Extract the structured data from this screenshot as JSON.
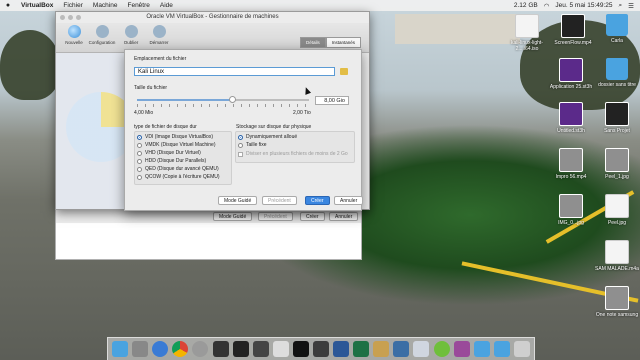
{
  "menubar": {
    "app_name": "VirtualBox",
    "menus": [
      "Fichier",
      "Machine",
      "Fenêtre",
      "Aide"
    ],
    "battery": "2.12 GB",
    "datetime": "Jeu. 5 mai 15:49:25",
    "user": "Carla"
  },
  "vbox_window": {
    "title": "Oracle VM VirtualBox - Gestionnaire de machines",
    "toolbar": [
      "Nouvelle",
      "Configuration",
      "Oublier",
      "Démarrer"
    ],
    "segments": [
      "Détails",
      "Instantanés"
    ]
  },
  "dialog": {
    "location_label": "Emplacement du fichier",
    "location_value": "Kali Linux",
    "size_label": "Taille du fichier",
    "size_value": "8,00 Gio",
    "size_fraction": 0.55,
    "size_min": "4,00 Mio",
    "size_max": "2,00 Tio",
    "type_label": "type de fichier de disque dur",
    "types": [
      "VDI (Image Disque VirtualBox)",
      "VMDK (Disque Virtuel Machine)",
      "VHD (Disque Dur Virtuel)",
      "HDD (Disque Dur Parallels)",
      "QED (Disque dur avancé QEMU)",
      "QCOW (Copie à l'écriture QEMU)"
    ],
    "storage_label": "Stockage sur disque dur physique",
    "storage_options": [
      "Dynamiquement alloué",
      "Taille fixe"
    ],
    "split_option": "Diviser en plusieurs fichiers de moins de 2 Go",
    "buttons": {
      "guided": "Mode Guidé",
      "previous": "Précédent",
      "create": "Créer",
      "cancel": "Annuler"
    }
  },
  "parent_buttons": {
    "guided": "Mode Guidé",
    "previous": "Précédent",
    "create": "Créer",
    "cancel": "Annuler"
  },
  "desktop_icons": [
    "kali-linux-light-2....i64.iso",
    "ScreenFlow.mp4",
    "Carla",
    "Application 25.st3h",
    "dossier sans titre",
    "Untitled.st3h",
    "Sans Projet",
    "Impro 56.mp4",
    "Peel_1.jpg",
    "IMG_0...jpg",
    "Peel.jpg",
    "SAM MALADE.m4a",
    "One note samsung"
  ]
}
